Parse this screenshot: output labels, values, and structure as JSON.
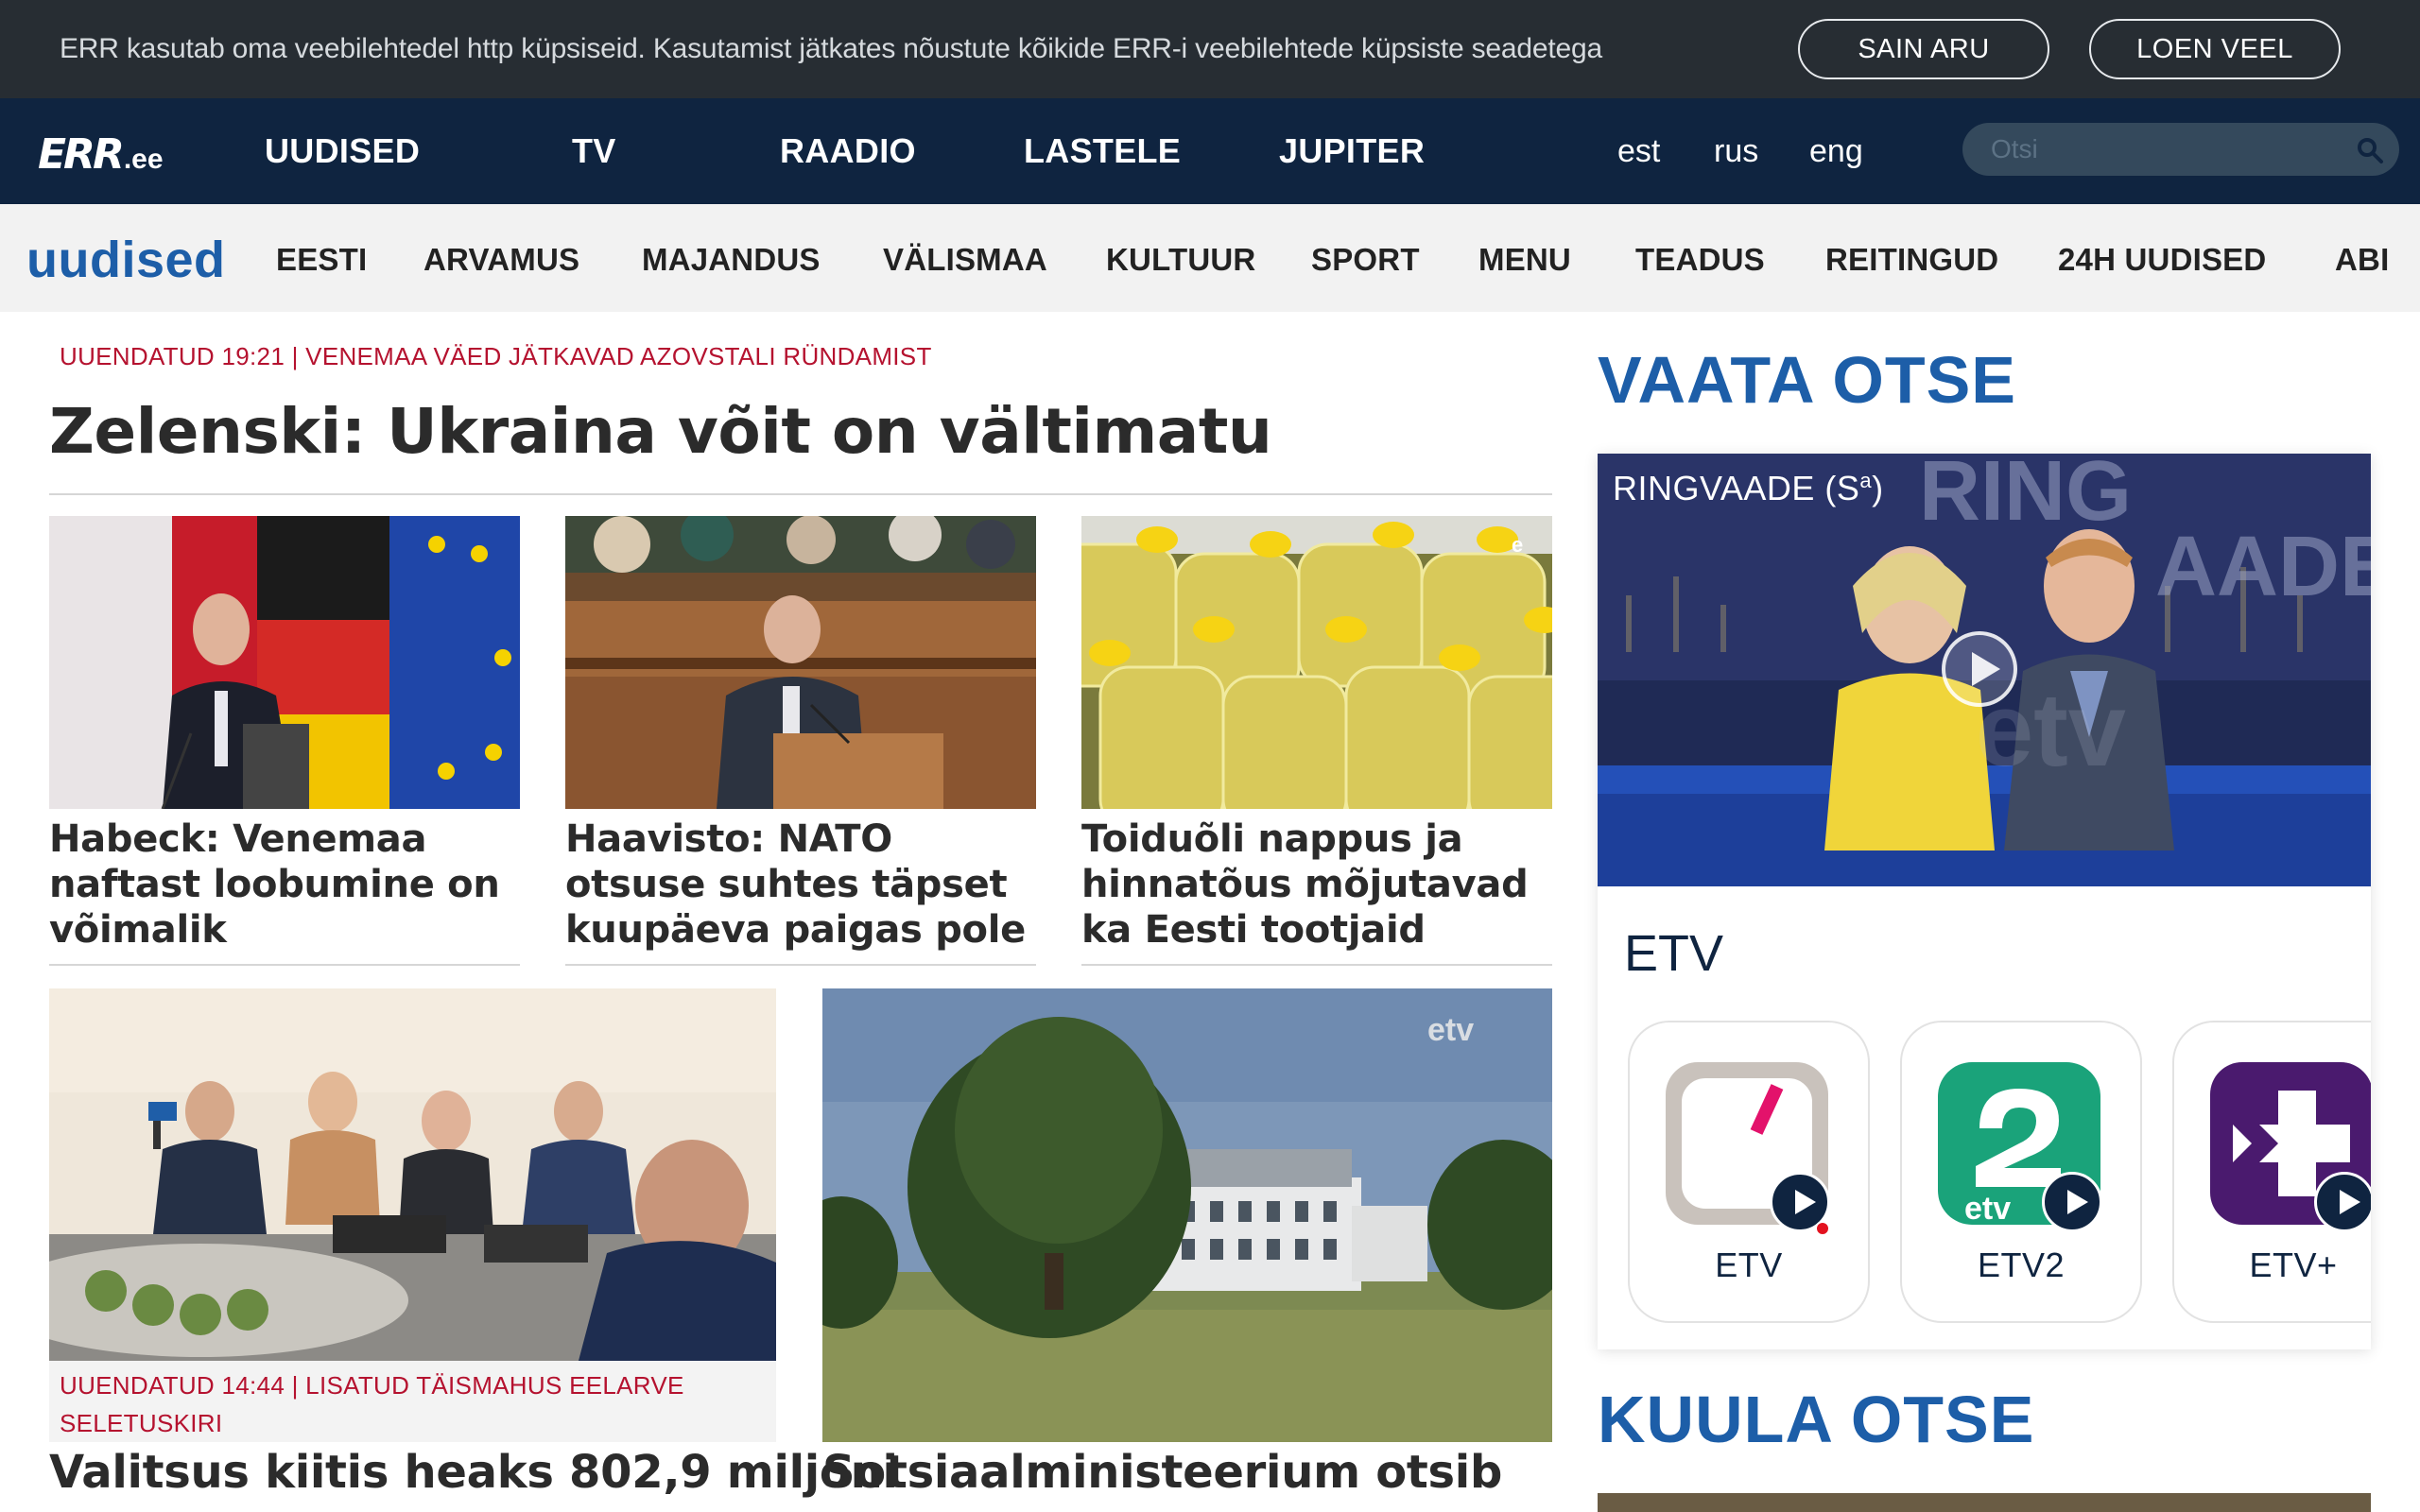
{
  "cookie": {
    "text": "ERR kasutab oma veebilehtedel http küpsiseid. Kasutamist jätkates nõustute kõikide ERR-i veebilehtede küpsiste seadetega",
    "accept_label": "SAIN ARU",
    "more_label": "LOEN VEEL"
  },
  "header": {
    "logo_main": "ERR",
    "logo_suffix": ".ee",
    "nav": [
      "UUDISED",
      "TV",
      "RAADIO",
      "LASTELE",
      "JUPITER"
    ],
    "languages": [
      "est",
      "rus",
      "eng"
    ],
    "search_placeholder": "Otsi"
  },
  "subnav": {
    "logo": "uudised",
    "items": [
      "EESTI",
      "ARVAMUS",
      "MAJANDUS",
      "VÄLISMAA",
      "KULTUUR",
      "SPORT",
      "MENU",
      "TEADUS",
      "REITINGUD",
      "24H UUDISED",
      "ABI"
    ]
  },
  "lead": {
    "kicker": "Uuendatud 19:21 | Venemaa väed jätkavad Azovstali ründamist",
    "title": "Zelenski: Ukraina võit on vältimatu"
  },
  "cards": [
    {
      "title": "Habeck: Venemaa naftast loobumine on võimalik",
      "image": "speaker-flags-photo"
    },
    {
      "title": "Haavisto: NATO otsuse suhtes täpset kuupäeva paigas pole",
      "image": "parliament-speaker-photo"
    },
    {
      "title": "Toiduõli nappus ja hinnatõus mõjutavad ka Eesti tootjaid",
      "image": "oil-bottles-photo",
      "watermark": "e"
    }
  ],
  "big_cards": [
    {
      "kicker": "Uuendatud 14:44 | Lisatud täismahus eelarve seletuskiri",
      "title": "Valitsus kiitis heaks 802,9 miljoni",
      "image": "government-meeting-photo"
    },
    {
      "title": "Sotsiaalministeerium otsib",
      "image": "building-tree-photo",
      "watermark": "etv"
    }
  ],
  "sidebar": {
    "watch_heading": "VAATA OTSE",
    "program": "RINGVAADE (S",
    "program_sup": "a",
    "program_close": ")",
    "channel_group": "ETV",
    "channels": [
      {
        "name": "ETV",
        "color": "#c9c2bc",
        "live_dot": true
      },
      {
        "name": "ETV2",
        "color": "#1aa37a",
        "live_dot": false
      },
      {
        "name": "ETV+",
        "color": "#4a1a6e",
        "live_dot": false
      }
    ],
    "listen_heading": "KUULA OTSE"
  },
  "colors": {
    "navy": "#0f2440",
    "brand_blue": "#1d5ea8",
    "kicker_red": "#b5122f",
    "cookie_bg": "#272d33"
  }
}
